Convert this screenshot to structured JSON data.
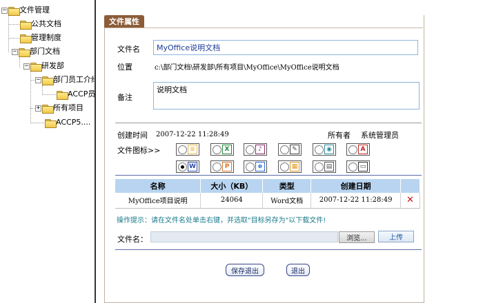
{
  "tree": {
    "root": "文件管理",
    "items": [
      "公共文档",
      "管理制度",
      "部门文档",
      "研发部",
      "部门员工介绍",
      "ACCP员",
      "所有项目",
      "ACCP5...."
    ]
  },
  "panel": {
    "tab_label": "文件属性",
    "filename_label": "文件名",
    "filename_value": "MyOffice说明文档",
    "location_label": "位置",
    "location_value": "c:\\部门文档\\研发部\\所有项目\\MyOffice\\MyOffice说明文档",
    "remark_label": "备注",
    "remark_value": "说明文档",
    "created_label": "创建时间",
    "created_value": "2007-12-22 11:28:49",
    "owner_label": "所有者",
    "owner_value": "系统管理员",
    "icon_label": "文件图标>>",
    "icons": [
      {
        "name": "text-doc-icon",
        "glyph": "≡",
        "color": "#e8b84a",
        "selected": false
      },
      {
        "name": "excel-icon",
        "glyph": "X",
        "color": "#1f8a3c",
        "selected": false
      },
      {
        "name": "onenote-icon",
        "glyph": "♪",
        "color": "#8a2a6a",
        "selected": false
      },
      {
        "name": "clipboard-icon",
        "glyph": "✎",
        "color": "#444444",
        "selected": false
      },
      {
        "name": "outlook-icon",
        "glyph": "◉",
        "color": "#2a8a9a",
        "selected": false
      },
      {
        "name": "acrobat-icon",
        "glyph": "A",
        "color": "#c02828",
        "selected": false
      },
      {
        "name": "word-icon",
        "glyph": "W",
        "color": "#2a4aa8",
        "selected": true
      },
      {
        "name": "powerpoint-icon",
        "glyph": "P",
        "color": "#d8742a",
        "selected": false
      },
      {
        "name": "ie-icon",
        "glyph": "e",
        "color": "#2a6ad8",
        "selected": false
      },
      {
        "name": "image-icon",
        "glyph": "▦",
        "color": "#e09a2a",
        "selected": false
      },
      {
        "name": "calc-icon",
        "glyph": "▤",
        "color": "#555555",
        "selected": false
      },
      {
        "name": "window-icon",
        "glyph": "▭",
        "color": "#333333",
        "selected": false
      }
    ]
  },
  "table": {
    "headers": [
      "名称",
      "大小（KB）",
      "类型",
      "创建日期",
      ""
    ],
    "rows": [
      {
        "name": "MyOffice项目说明",
        "size": "24064",
        "type": "Word文档",
        "date": "2007-12-22 11:28:49",
        "delete": "✕"
      }
    ]
  },
  "upload": {
    "tip": "操作提示：请在文件名处单击右键，并选取\"目标另存为\"以下载文件!",
    "file_label": "文件名：",
    "browse_label": "浏览...",
    "upload_label": "上传"
  },
  "actions": {
    "save_exit": "保存退出",
    "exit": "退出"
  }
}
